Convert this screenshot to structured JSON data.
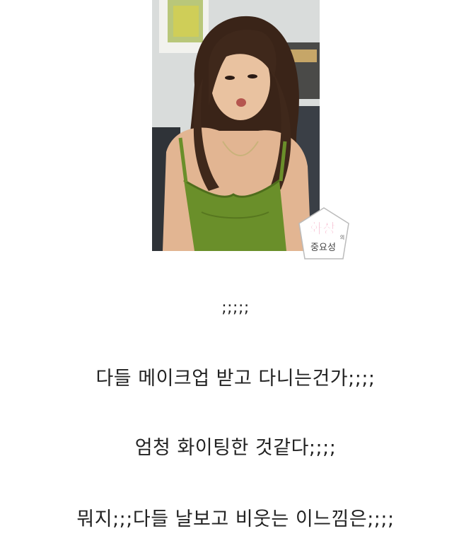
{
  "photo": {
    "watermark": {
      "line1": "화장",
      "line2": "중요성",
      "small": "의"
    }
  },
  "text_lines": [
    ";;;;;",
    "다들 메이크업 받고 다니는건가;;;;",
    "엄청 화이팅한 것같다;;;;",
    "뭐지;;;다들 날보고 비웃는 이느낌은;;;;"
  ],
  "colors": {
    "dress": "#6a8f2a",
    "hair": "#3a2418",
    "watermark_pink": "#e8457c"
  }
}
